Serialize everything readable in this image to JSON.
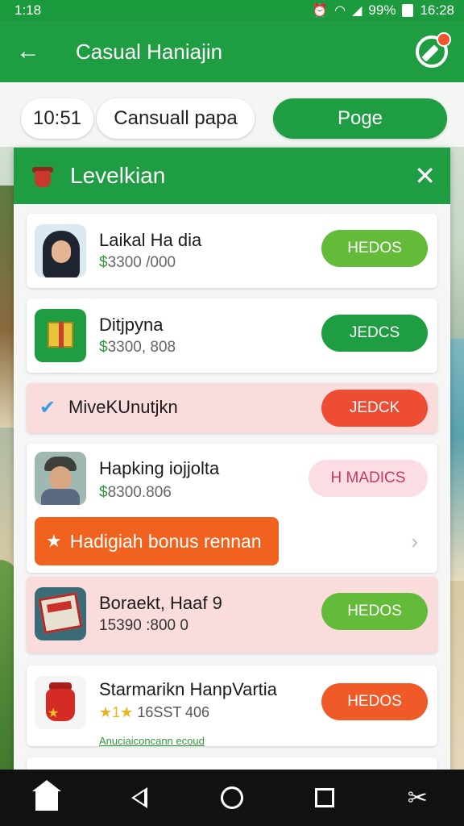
{
  "status_bar": {
    "time": "1:18",
    "battery_text": "99%",
    "clock": "16:28"
  },
  "app_bar": {
    "title": "Casual Haniajin"
  },
  "filters": {
    "time_chip": "10:51",
    "name_chip": "Cansuall papa",
    "page_button": "Poge"
  },
  "sheet": {
    "title": "Levelkian",
    "items": [
      {
        "name": "Laikal Ha dia",
        "price_symbol": "$",
        "price": "3300 /000",
        "action": "HEDOS"
      },
      {
        "name": "Ditjpyna",
        "price_symbol": "$",
        "price": "3300, 808",
        "action": "JEDCS"
      },
      {
        "name": "MiveKUnutjkn",
        "action": "JEDCK"
      },
      {
        "name": "Hapking iojjolta",
        "price_symbol": "$",
        "price": "8300.806",
        "action": "H MADICS",
        "bonus": "Hadigiah bonus rennan"
      },
      {
        "name": "Boraekt, Haaf 9",
        "price": "15390 :800 0",
        "action": "HEDOS"
      },
      {
        "name": "Starmarikn HanpVartia",
        "rating_stars": "★1★",
        "rating": "16SST 406",
        "link": "Anuciaiconcann ecoud",
        "action": "HEDOS"
      }
    ]
  },
  "icons": {
    "back": "back-arrow-icon",
    "edit": "edit-icon",
    "close": "close-icon",
    "check": "check-icon",
    "star": "star-icon",
    "chevron": "chevron-right-icon",
    "home": "home-icon",
    "nav_back": "nav-back-icon",
    "nav_home": "nav-home-circle-icon",
    "recents": "recents-square-icon",
    "screenshot": "screenshot-icon"
  },
  "colors": {
    "primary_green": "#1f9d42",
    "lime": "#64bb3a",
    "orange": "#f05a28",
    "red": "#ef4d33",
    "pink_row": "#fbdcdc"
  }
}
